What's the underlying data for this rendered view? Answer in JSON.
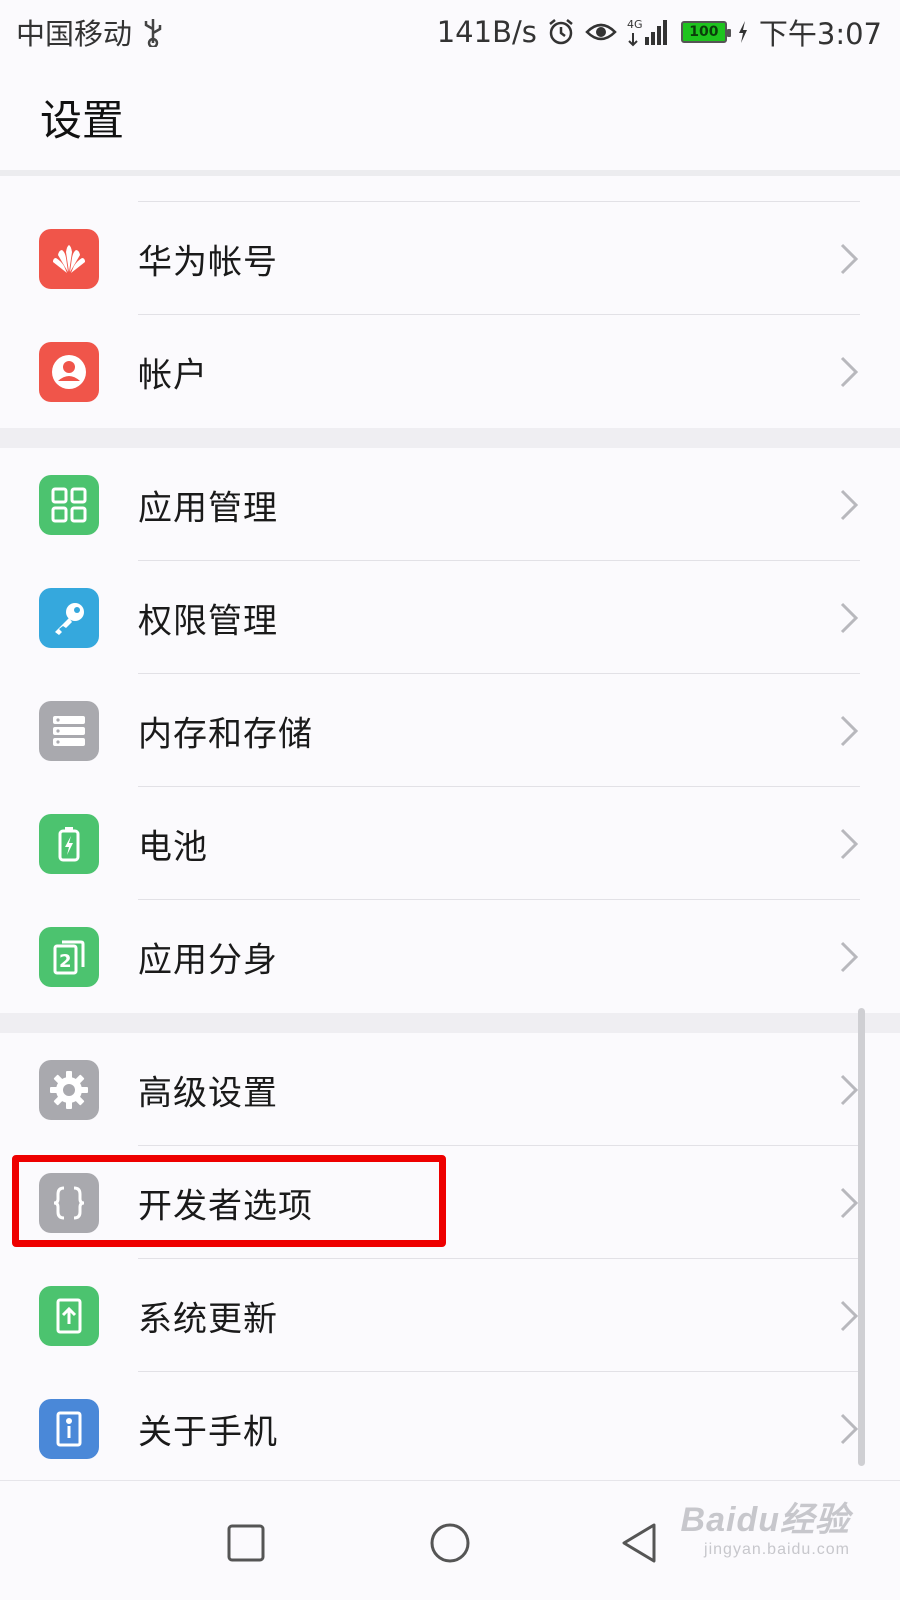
{
  "status_bar": {
    "carrier": "中国移动",
    "net_speed": "141B/s",
    "network_type": "4G",
    "battery": "100",
    "time": "下午3:07"
  },
  "header": {
    "title": "设置"
  },
  "groups": [
    {
      "items": [
        {
          "label": "华为帐号",
          "icon": "huawei-logo-icon",
          "color": "#f0554a"
        },
        {
          "label": "帐户",
          "icon": "user-icon",
          "color": "#f0554a"
        }
      ]
    },
    {
      "items": [
        {
          "label": "应用管理",
          "icon": "apps-grid-icon",
          "color": "#4cc36f"
        },
        {
          "label": "权限管理",
          "icon": "key-icon",
          "color": "#35a8dd"
        },
        {
          "label": "内存和存储",
          "icon": "storage-icon",
          "color": "#a9a9ae"
        },
        {
          "label": "电池",
          "icon": "battery-icon",
          "color": "#4cc36f"
        },
        {
          "label": "应用分身",
          "icon": "app-twin-icon",
          "color": "#4cc36f"
        }
      ]
    },
    {
      "items": [
        {
          "label": "高级设置",
          "icon": "gear-icon",
          "color": "#a9a9ae"
        },
        {
          "label": "开发者选项",
          "icon": "braces-icon",
          "color": "#a9a9ae",
          "highlighted": true
        },
        {
          "label": "系统更新",
          "icon": "system-update-icon",
          "color": "#4cc36f"
        },
        {
          "label": "关于手机",
          "icon": "info-icon",
          "color": "#4a88d8"
        }
      ]
    }
  ],
  "watermark": {
    "brand": "Baidu经验",
    "url": "jingyan.baidu.com"
  },
  "colors": {
    "highlight": "#ee0000",
    "background": "#fbfafd",
    "group_gap": "#efeef2"
  }
}
